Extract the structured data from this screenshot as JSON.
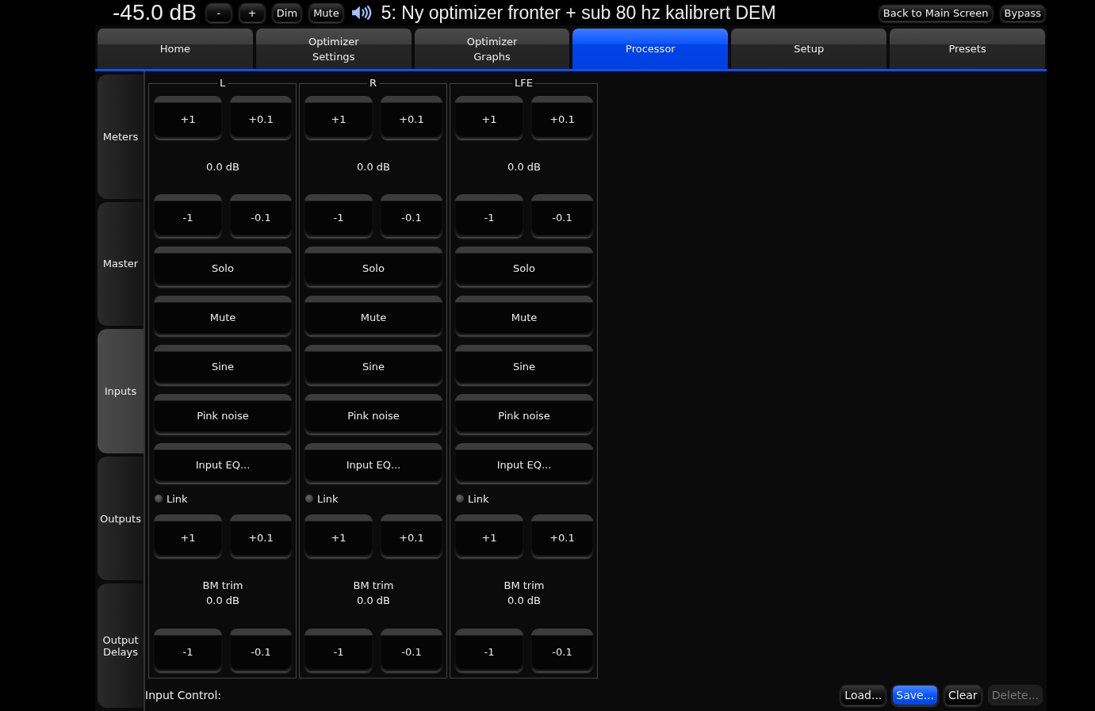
{
  "top_bar": {
    "volume": "-45.0 dB",
    "buttons": [
      "-",
      "+",
      "Dim",
      "Mute"
    ],
    "title": "5: Ny optimizer fronter + sub 80 hz kalibrert DEM",
    "right_buttons": [
      "Back to Main Screen",
      "Bypass"
    ]
  },
  "tabs": [
    {
      "label": "Home",
      "selected": false
    },
    {
      "label": "Optimizer\nSettings",
      "selected": false
    },
    {
      "label": "Optimizer\nGraphs",
      "selected": false
    },
    {
      "label": "Processor",
      "selected": true
    },
    {
      "label": "Setup",
      "selected": false
    },
    {
      "label": "Presets",
      "selected": false
    }
  ],
  "sidebar": {
    "items": [
      {
        "label": "Meters",
        "selected": false
      },
      {
        "label": "Master",
        "selected": false
      },
      {
        "label": "Inputs",
        "selected": true
      },
      {
        "label": "Outputs",
        "selected": false
      },
      {
        "label": "Output\nDelays",
        "selected": false
      }
    ]
  },
  "channels": [
    {
      "name": "L",
      "gain_up": [
        "+1",
        "+0.1"
      ],
      "gain": "0.0 dB",
      "gain_down": [
        "-1",
        "-0.1"
      ],
      "buttons": [
        "Solo",
        "Mute",
        "Sine",
        "Pink noise",
        "Input EQ..."
      ],
      "link": {
        "label": "Link",
        "on": false
      },
      "trim_up": [
        "+1",
        "+0.1"
      ],
      "trim_label": "BM trim",
      "trim": "0.0 dB",
      "trim_down": [
        "-1",
        "-0.1"
      ]
    },
    {
      "name": "R",
      "gain_up": [
        "+1",
        "+0.1"
      ],
      "gain": "0.0 dB",
      "gain_down": [
        "-1",
        "-0.1"
      ],
      "buttons": [
        "Solo",
        "Mute",
        "Sine",
        "Pink noise",
        "Input EQ..."
      ],
      "link": {
        "label": "Link",
        "on": false
      },
      "trim_up": [
        "+1",
        "+0.1"
      ],
      "trim_label": "BM trim",
      "trim": "0.0 dB",
      "trim_down": [
        "-1",
        "-0.1"
      ]
    },
    {
      "name": "LFE",
      "gain_up": [
        "+1",
        "+0.1"
      ],
      "gain": "0.0 dB",
      "gain_down": [
        "-1",
        "-0.1"
      ],
      "buttons": [
        "Solo",
        "Mute",
        "Sine",
        "Pink noise",
        "Input EQ..."
      ],
      "link": {
        "label": "Link",
        "on": false
      },
      "trim_up": [
        "+1",
        "+0.1"
      ],
      "trim_label": "BM trim",
      "trim": "0.0 dB",
      "trim_down": [
        "-1",
        "-0.1"
      ]
    }
  ],
  "footer": {
    "label": "Input Control:",
    "buttons": [
      {
        "label": "Load...",
        "highlighted": false,
        "disabled": false
      },
      {
        "label": "Save...",
        "highlighted": true,
        "disabled": false
      },
      {
        "label": "Clear",
        "highlighted": false,
        "disabled": false
      },
      {
        "label": "Delete...",
        "highlighted": false,
        "disabled": true
      }
    ]
  }
}
